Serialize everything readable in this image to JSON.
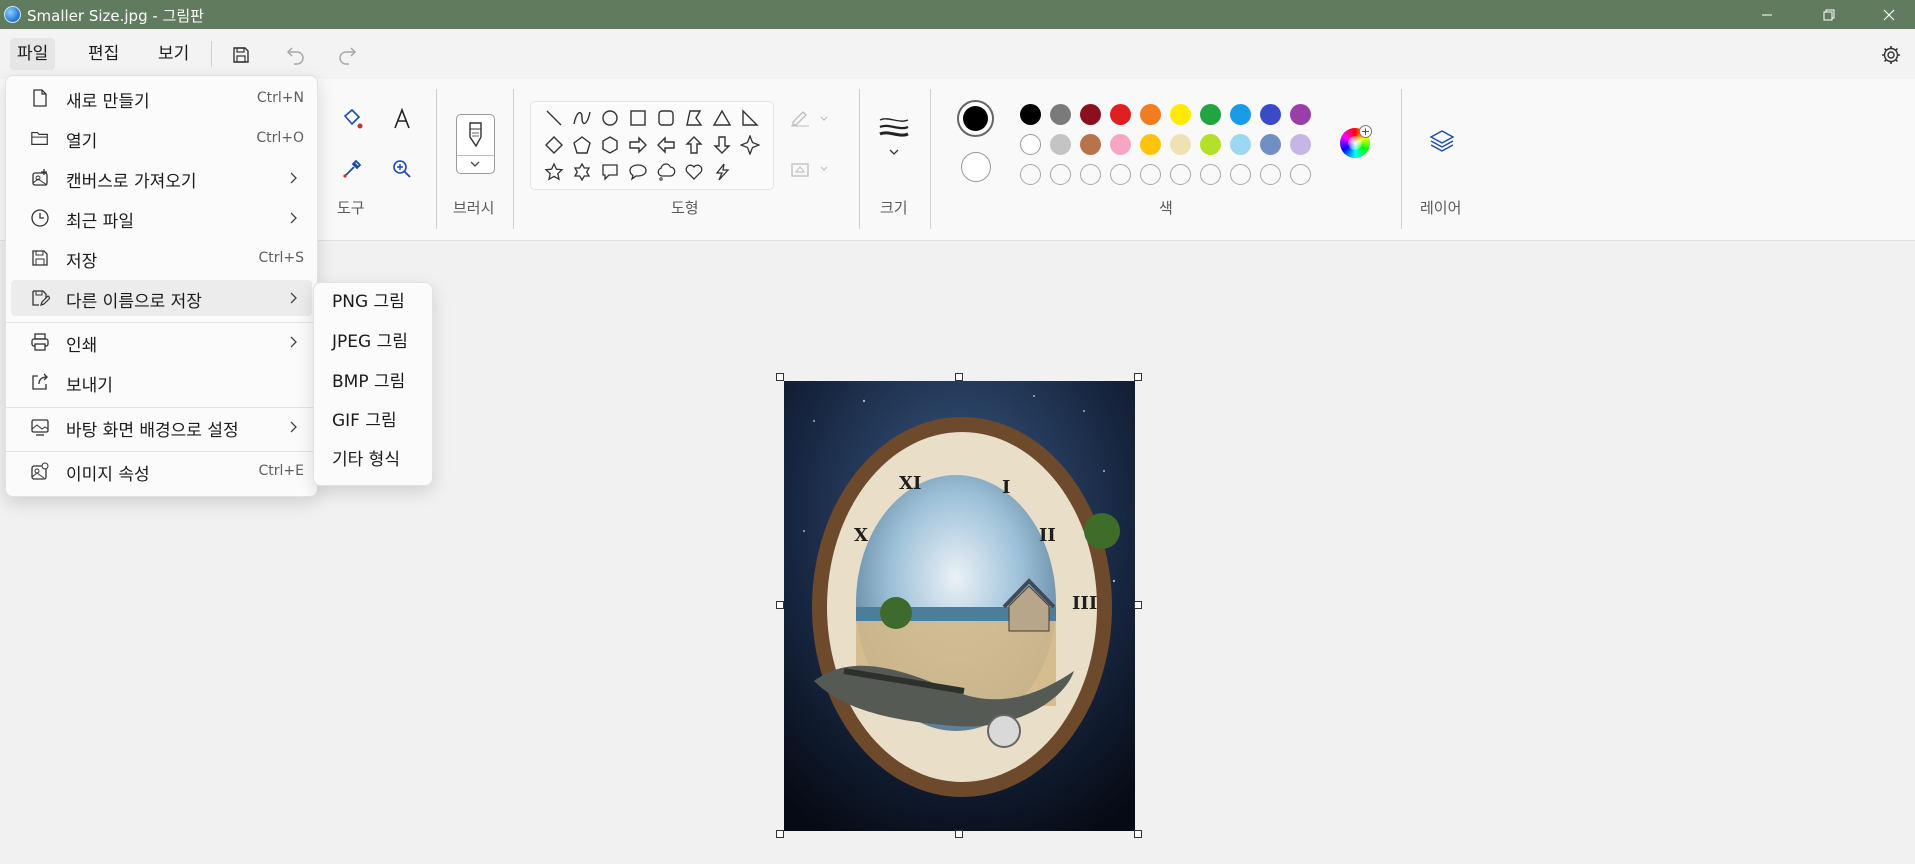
{
  "window": {
    "title": "Smaller Size.jpg - 그림판",
    "app_icon": "paint-app-icon",
    "titlebar_color": "#617b5f"
  },
  "menubar": {
    "file": "파일",
    "edit": "편집",
    "view": "보기"
  },
  "ribbon": {
    "groups": {
      "tools": "도구",
      "brushes": "브러시",
      "shapes": "도형",
      "size": "크기",
      "colors": "색",
      "layers": "레이어"
    },
    "selected_color_primary": "#000000",
    "selected_color_secondary": "#ffffff",
    "palette_row1": [
      "#000000",
      "#7a7a7a",
      "#8a1020",
      "#e02020",
      "#f47c20",
      "#ffea00",
      "#22a540",
      "#1a9be8",
      "#3b4bc8",
      "#9a3ea8"
    ],
    "palette_row2": [
      "#ffffff",
      "#c4c4c4",
      "#b8734a",
      "#f6a6c4",
      "#ffc30e",
      "#efe2b2",
      "#b5e02a",
      "#9cd9f0",
      "#7090c4",
      "#c6b6e6"
    ]
  },
  "file_menu": {
    "items": [
      {
        "label": "새로 만들기",
        "shortcut": "Ctrl+N",
        "icon": "new-file-icon"
      },
      {
        "label": "열기",
        "shortcut": "Ctrl+O",
        "icon": "open-folder-icon"
      },
      {
        "label": "캔버스로 가져오기",
        "shortcut": "",
        "icon": "import-image-icon"
      },
      {
        "label": "최근 파일",
        "shortcut": "",
        "icon": "clock-icon"
      },
      {
        "label": "저장",
        "shortcut": "Ctrl+S",
        "icon": "save-icon"
      },
      {
        "label": "다른 이름으로 저장",
        "shortcut": "",
        "icon": "save-as-icon"
      },
      {
        "label": "인쇄",
        "shortcut": "",
        "icon": "printer-icon"
      },
      {
        "label": "보내기",
        "shortcut": "",
        "icon": "share-icon"
      },
      {
        "label": "바탕 화면 배경으로 설정",
        "shortcut": "",
        "icon": "wallpaper-icon"
      },
      {
        "label": "이미지 속성",
        "shortcut": "Ctrl+E",
        "icon": "image-properties-icon"
      }
    ]
  },
  "save_as_submenu": {
    "items": [
      "PNG 그림",
      "JPEG 그림",
      "BMP 그림",
      "GIF 그림",
      "기타 형식"
    ]
  }
}
